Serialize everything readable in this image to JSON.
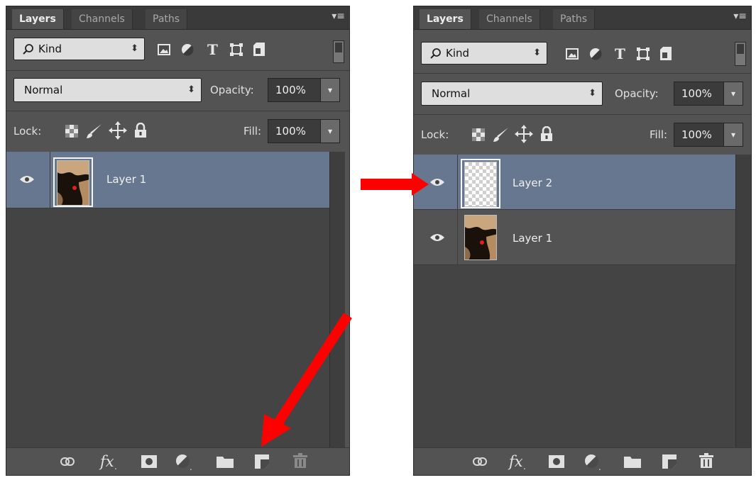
{
  "tabs": [
    "Layers",
    "Channels",
    "Paths"
  ],
  "tab_menu_icon": "panel-menu-icon",
  "filter": {
    "kind_label": "Kind",
    "arrows": "⬍"
  },
  "blend": {
    "mode": "Normal",
    "arrows": "⬍",
    "opacity_label": "Opacity:",
    "opacity_value": "100%"
  },
  "lock": {
    "label": "Lock:",
    "fill_label": "Fill:",
    "fill_value": "100%"
  },
  "dropdown_glyph": "▾",
  "left_panel": {
    "layers": [
      {
        "name": "Layer 1",
        "selected": true,
        "thumb": "image"
      }
    ]
  },
  "right_panel": {
    "layers": [
      {
        "name": "Layer 2",
        "selected": true,
        "thumb": "transparent"
      },
      {
        "name": "Layer 1",
        "selected": false,
        "thumb": "image"
      }
    ]
  },
  "footer_icons": [
    "link-layers-icon",
    "fx-icon",
    "layer-mask-icon",
    "adjustment-layer-icon",
    "new-group-icon",
    "new-layer-icon",
    "delete-layer-icon"
  ],
  "colors": {
    "panel_bg": "#535353",
    "selected_row": "#66778f",
    "annotation_arrow": "#ff0000"
  }
}
